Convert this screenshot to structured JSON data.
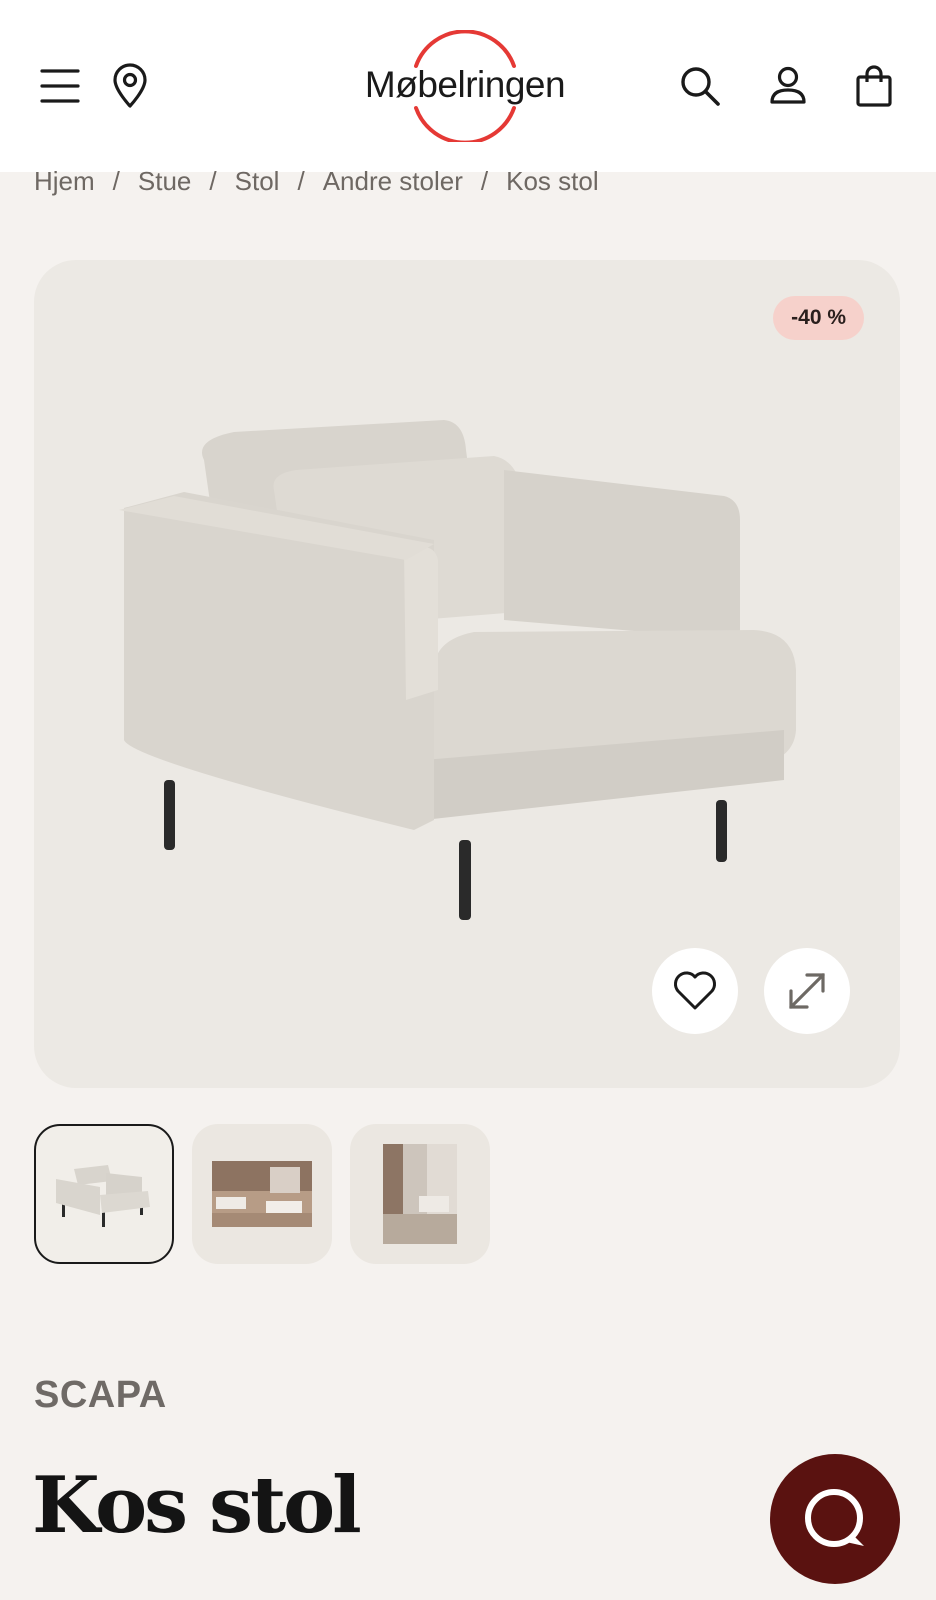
{
  "header": {
    "logo_text": "Møbelringen",
    "icons": [
      "menu-icon",
      "location-pin-icon",
      "search-icon",
      "user-icon",
      "shopping-bag-icon"
    ]
  },
  "breadcrumb": {
    "items": [
      "Hjem",
      "Stue",
      "Stol",
      "Andre stoler",
      "Kos stol"
    ],
    "separator": "/"
  },
  "gallery": {
    "discount_badge": "-40 %",
    "icons": [
      "heart-icon",
      "expand-icon"
    ],
    "thumbnail_count": 3
  },
  "product": {
    "brand": "SCAPA",
    "name": "Kos stol"
  },
  "colors": {
    "accent_red": "#e53935",
    "chat_button": "#5a1210",
    "badge_bg": "#f6d1cb",
    "page_bg": "#f5f2ef"
  }
}
